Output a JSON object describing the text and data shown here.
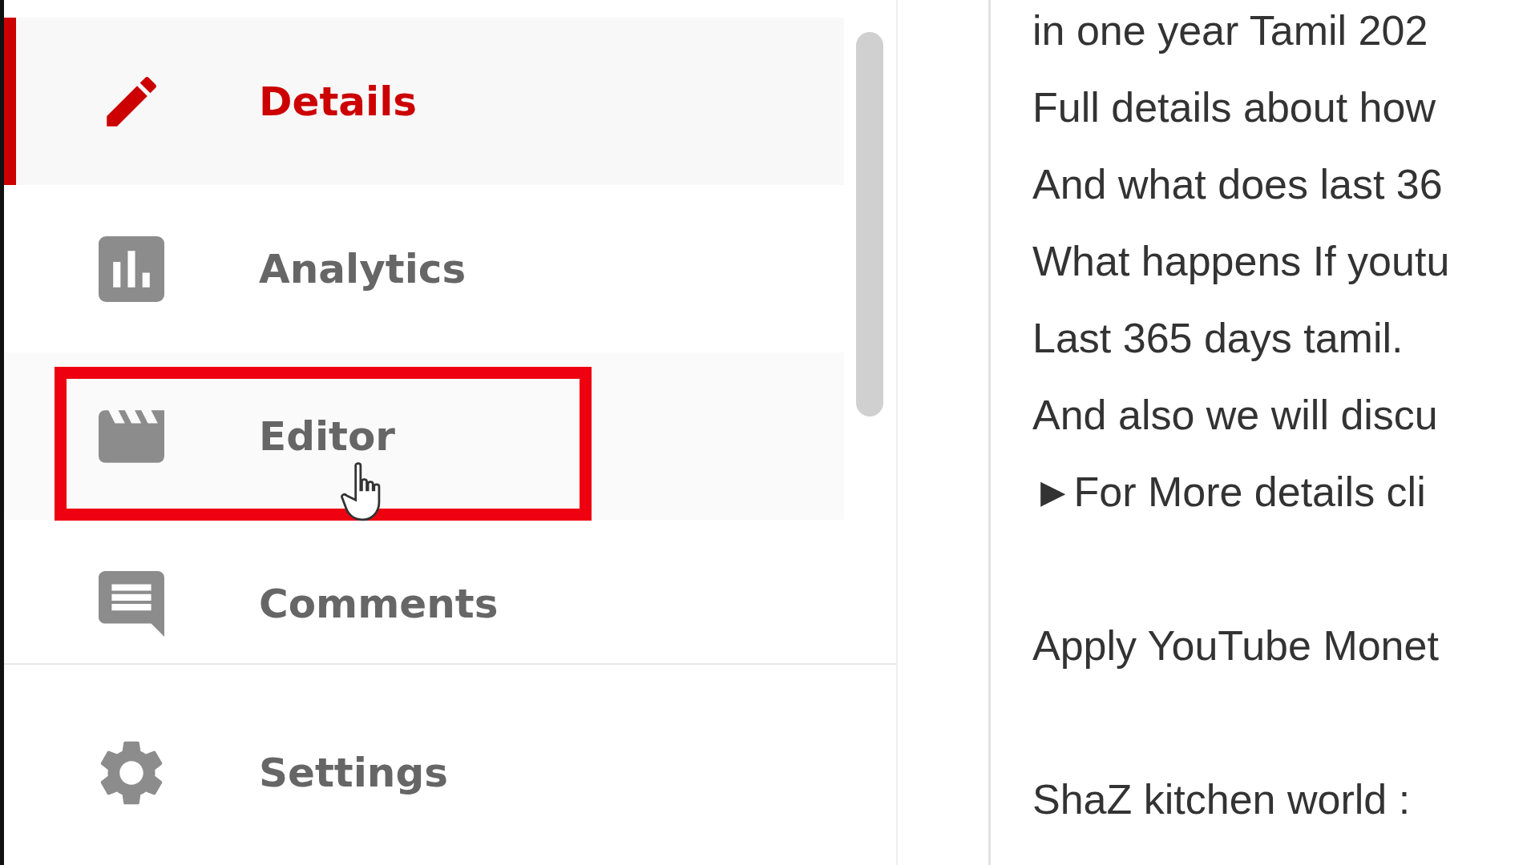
{
  "sidebar": {
    "items": [
      {
        "label": "Details",
        "kind": "pencil",
        "selected": true,
        "annotated": false
      },
      {
        "label": "Analytics",
        "kind": "chart",
        "selected": false,
        "annotated": false
      },
      {
        "label": "Editor",
        "kind": "clapper",
        "selected": false,
        "annotated": true
      },
      {
        "label": "Comments",
        "kind": "comment",
        "selected": false,
        "annotated": false
      }
    ],
    "footer_items": [
      {
        "label": "Settings",
        "kind": "gear",
        "selected": false,
        "annotated": false
      }
    ]
  },
  "description": {
    "paragraphs": [
      {
        "lines": [
          "in one year Tamil 202",
          "Full details about how",
          "And what does last 36",
          "What happens If youtu",
          "Last 365 days tamil.",
          "And also we will discu",
          "►For More details cli"
        ]
      },
      {
        "lines": [
          "Apply YouTube Monet"
        ]
      },
      {
        "lines": [
          "ShaZ kitchen world :"
        ]
      }
    ]
  }
}
